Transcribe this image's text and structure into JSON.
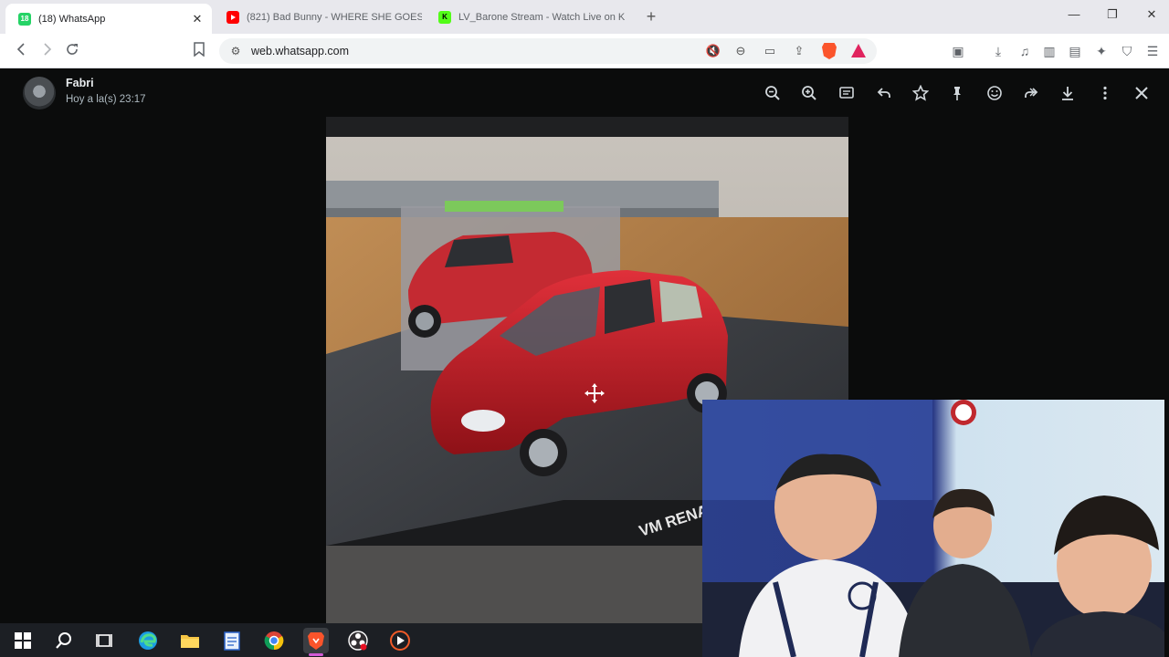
{
  "browser": {
    "tabs": [
      {
        "title": "(18) WhatsApp",
        "badge": "18",
        "favicon": "whatsapp-icon",
        "favicon_color": "#25d366",
        "active": true
      },
      {
        "title": "(821) Bad Bunny - WHERE SHE GOES",
        "favicon": "youtube-icon",
        "favicon_color": "#ff0000",
        "active": false
      },
      {
        "title": "LV_Barone Stream - Watch Live on Kick",
        "favicon": "kick-icon",
        "favicon_color": "#53fc18",
        "active": false
      }
    ],
    "new_tab_label": "+",
    "address": {
      "url": "web.whatsapp.com"
    }
  },
  "viewer": {
    "sender_name": "Fabri",
    "timestamp": "Hoy a la(s) 23:17",
    "toolbar_icons": [
      "zoom-out-icon",
      "zoom-in-icon",
      "message-icon",
      "reply-icon",
      "star-icon",
      "pin-icon",
      "emoji-icon",
      "forward-icon",
      "download-icon",
      "more-icon",
      "close-icon"
    ],
    "photo_caption_text": "VM RENAULT"
  },
  "taskbar": {
    "items": [
      "windows-start-icon",
      "search-icon",
      "task-view-icon",
      "edge-icon",
      "file-explorer-icon",
      "notepad-icon",
      "chrome-icon",
      "brave-icon",
      "obs-icon",
      "media-player-icon"
    ]
  }
}
